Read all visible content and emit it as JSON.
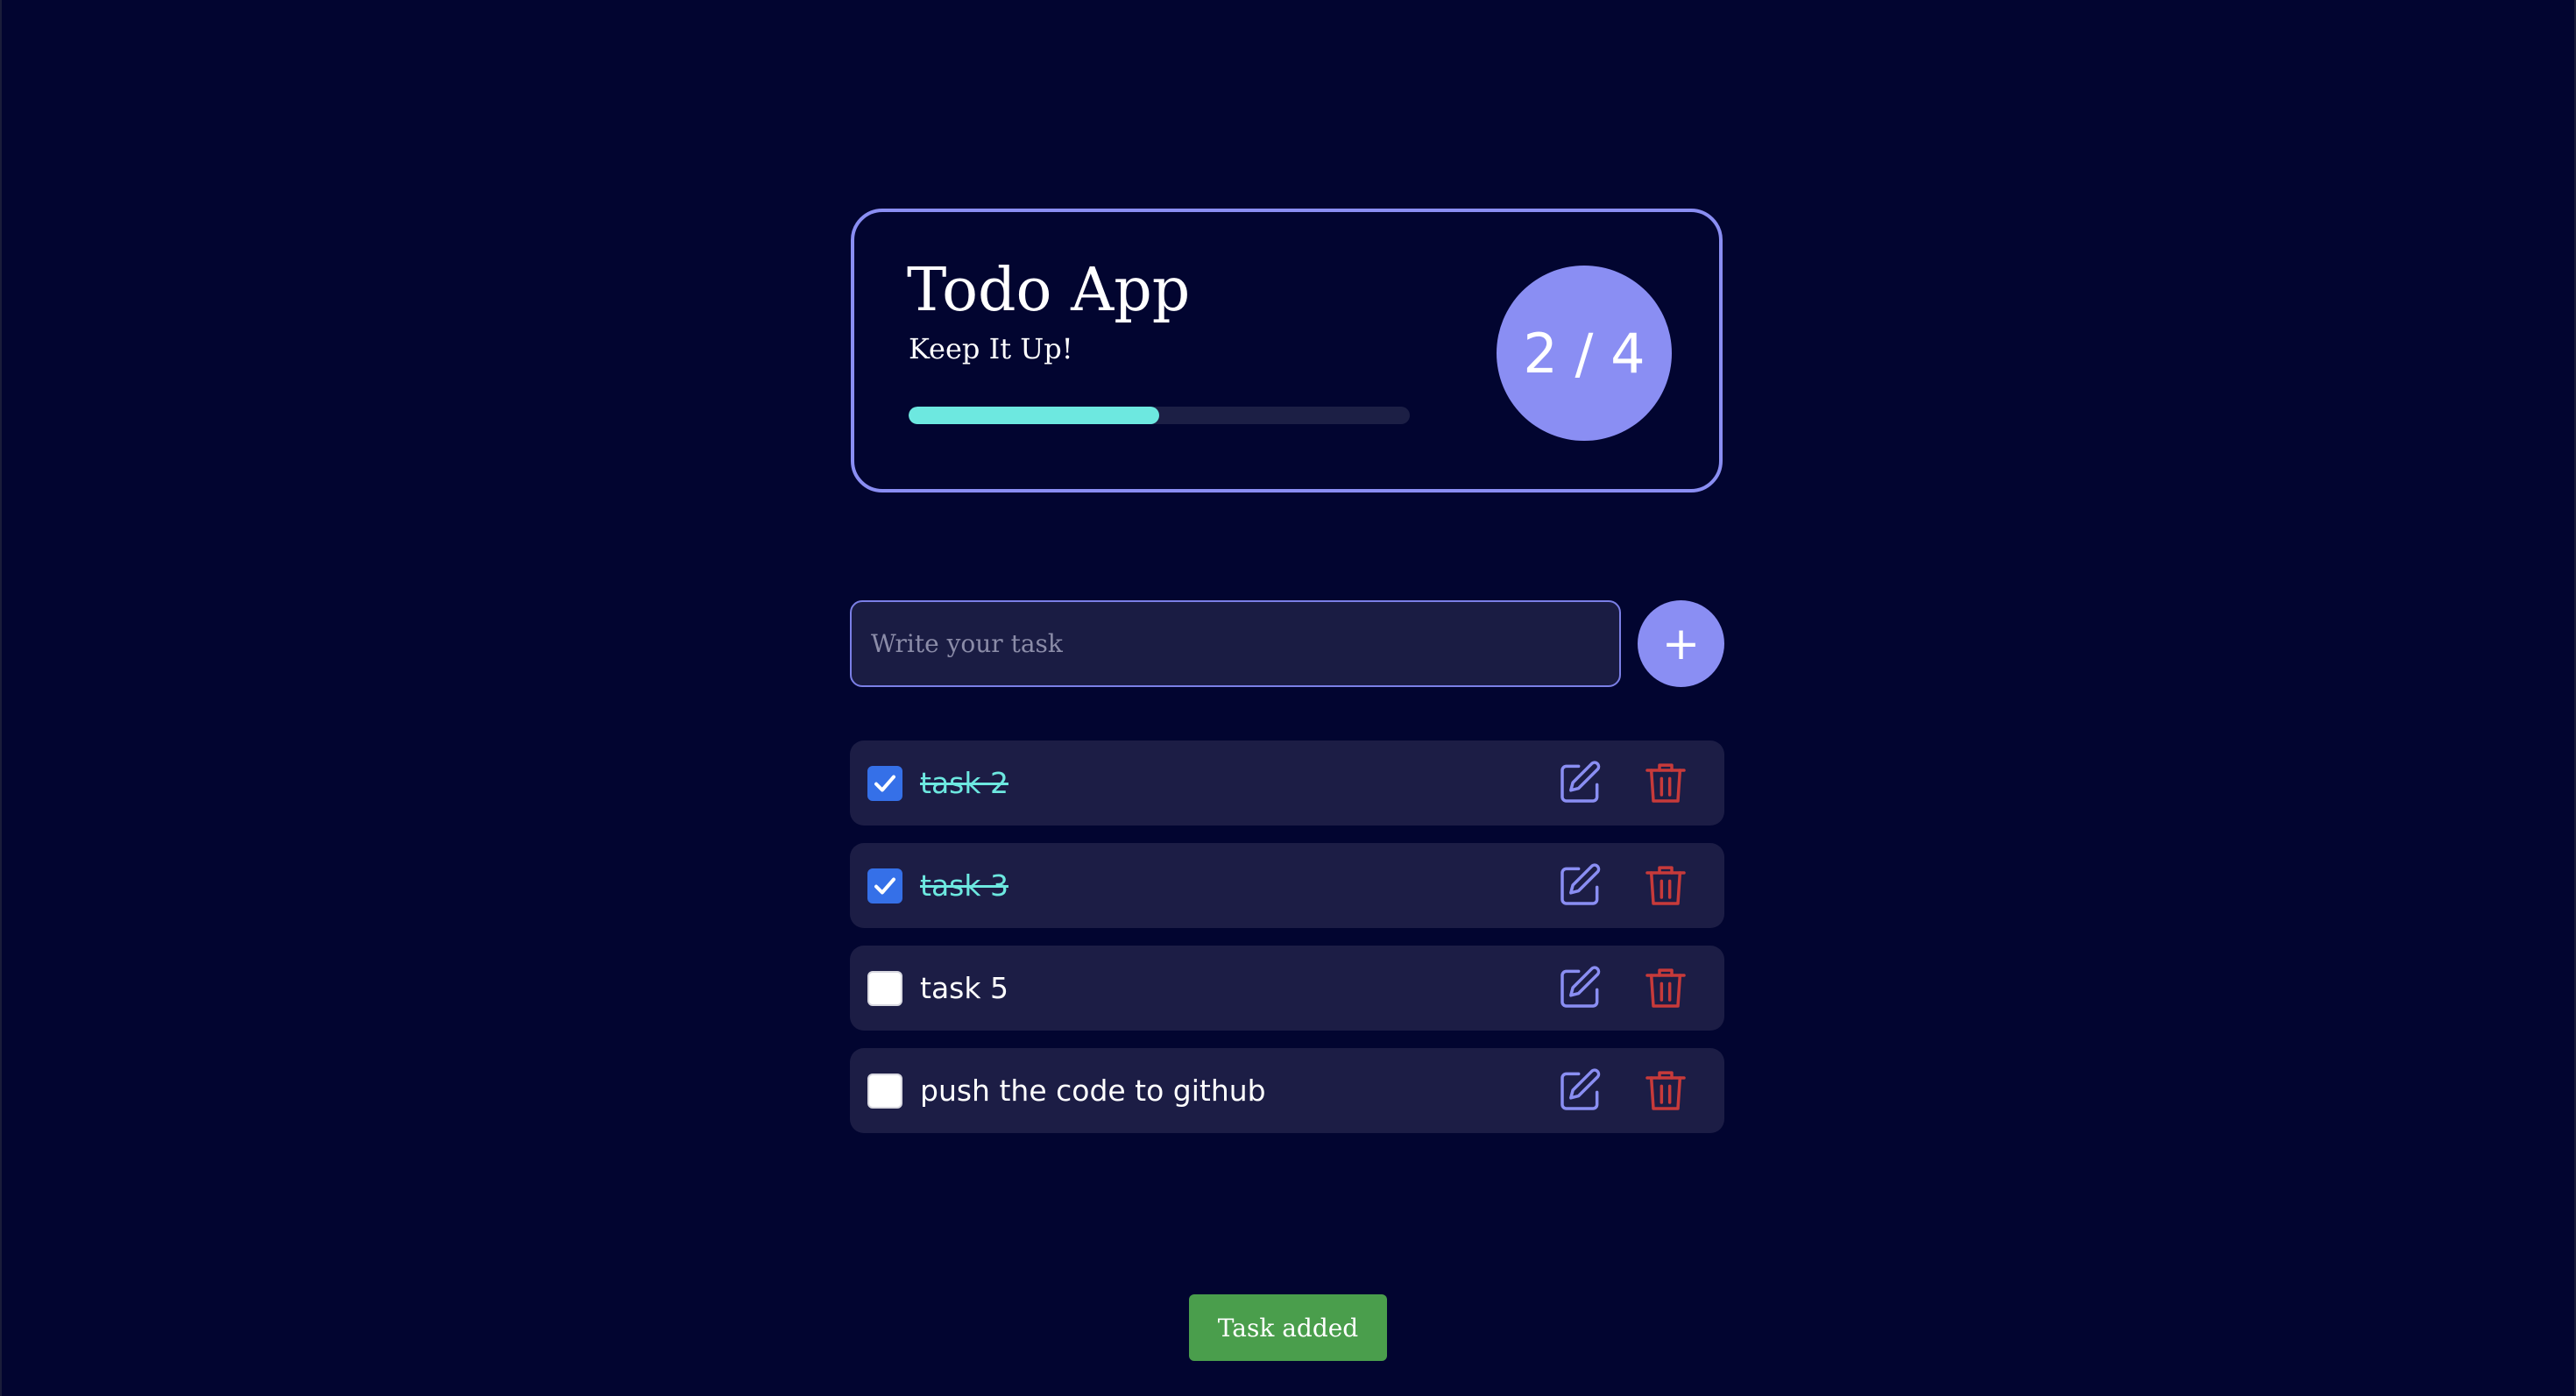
{
  "header": {
    "title": "Todo App",
    "subtitle": "Keep It Up!",
    "progress_fraction": 0.5,
    "counter_text": "2 / 4"
  },
  "input": {
    "placeholder": "Write your task",
    "value": "",
    "add_button_label": "+"
  },
  "tasks": [
    {
      "label": "task 2",
      "completed": true
    },
    {
      "label": "task 3",
      "completed": true
    },
    {
      "label": "task 5",
      "completed": false
    },
    {
      "label": "push the code to github",
      "completed": false
    }
  ],
  "toast": {
    "text": "Task added"
  },
  "colors": {
    "background": "#020530",
    "accent": "#8a8ef3",
    "completed_text": "#6de8e0",
    "delete": "#c73a3a",
    "toast": "#4a9e4c",
    "checkbox_checked": "#3570e8"
  },
  "icons": {
    "add": "plus-icon",
    "edit": "edit-icon",
    "delete": "trash-icon",
    "check": "checkmark-icon"
  }
}
